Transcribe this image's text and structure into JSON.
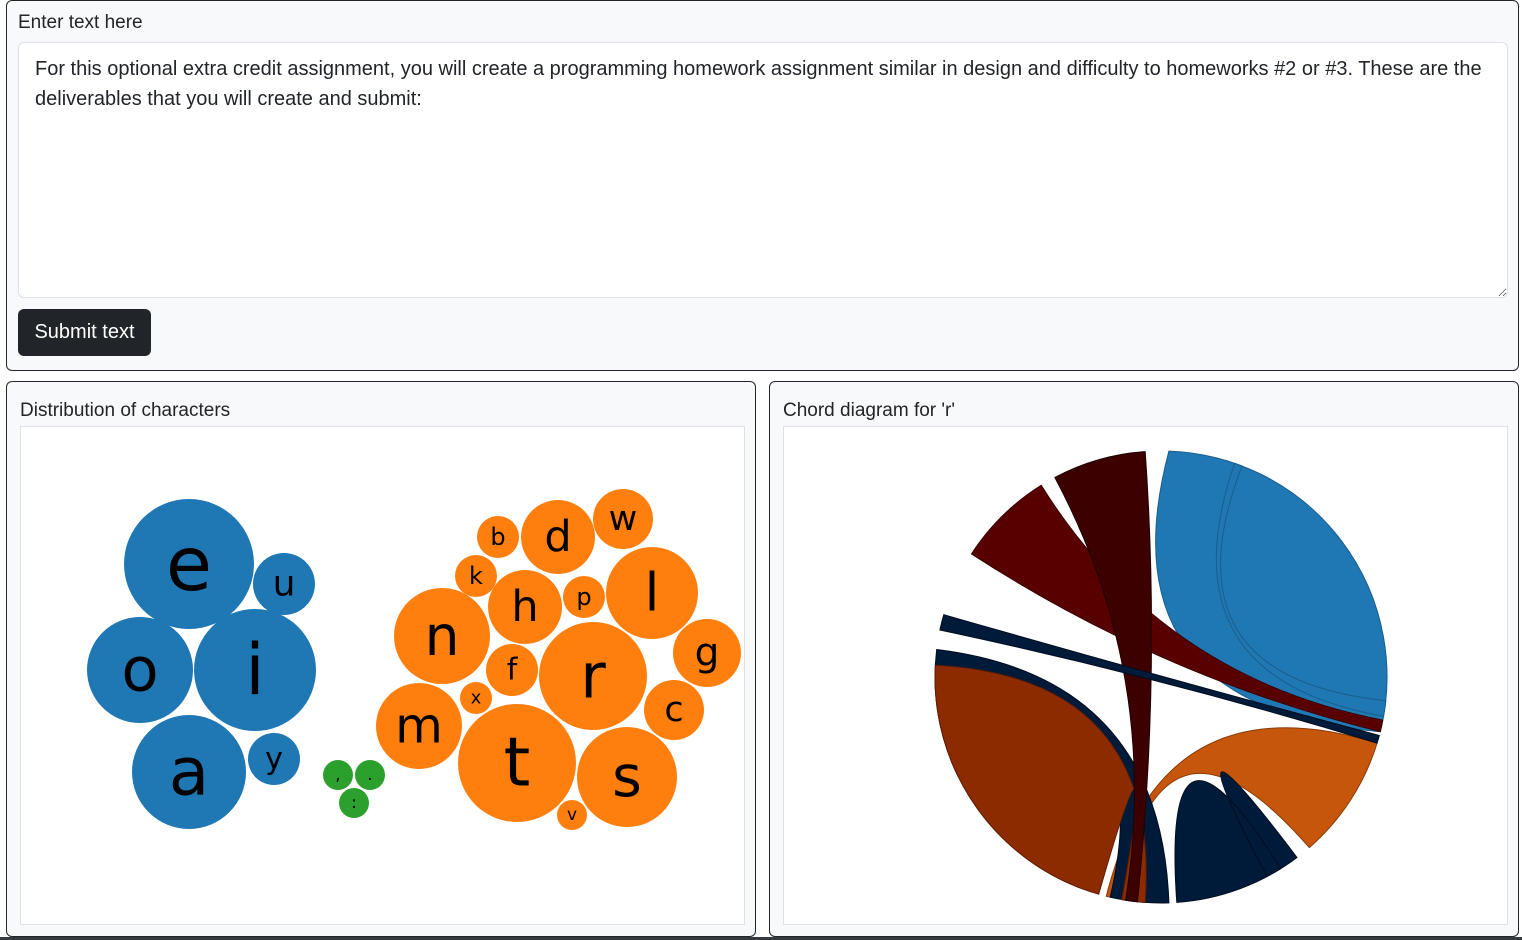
{
  "input_card": {
    "label": "Enter text here",
    "text_value": "For this optional extra credit assignment, you will create a programming homework assignment similar in design and difficulty to homeworks #2 or #3. These are the deliverables that you will create and submit:",
    "submit_label": "Submit text"
  },
  "distribution": {
    "title": "Distribution of characters",
    "colors": {
      "vowels": "#1f77b4",
      "punctuation": "#2ca02c",
      "consonants": "#ff7f0e"
    }
  },
  "chord": {
    "title": "Chord diagram for 'r'",
    "colors": [
      "#1f77b4",
      "#c5560b",
      "#001a39",
      "#8c2a00",
      "#580000",
      "#3c0000"
    ]
  },
  "chart_data": [
    {
      "type": "bubble",
      "title": "Distribution of characters",
      "groups": [
        {
          "name": "vowels",
          "items": [
            {
              "char": "e",
              "count": 27
            },
            {
              "char": "i",
              "count": 24
            },
            {
              "char": "a",
              "count": 21
            },
            {
              "char": "o",
              "count": 18
            },
            {
              "char": "u",
              "count": 6
            },
            {
              "char": "y",
              "count": 4
            }
          ]
        },
        {
          "name": "punctuation",
          "items": [
            {
              "char": ",",
              "count": 1
            },
            {
              "char": ".",
              "count": 1
            },
            {
              "char": ":",
              "count": 1
            }
          ]
        },
        {
          "name": "consonants",
          "items": [
            {
              "char": "t",
              "count": 22
            },
            {
              "char": "r",
              "count": 19
            },
            {
              "char": "s",
              "count": 16
            },
            {
              "char": "n",
              "count": 15
            },
            {
              "char": "l",
              "count": 13
            },
            {
              "char": "m",
              "count": 12
            },
            {
              "char": "h",
              "count": 9
            },
            {
              "char": "d",
              "count": 8
            },
            {
              "char": "g",
              "count": 7
            },
            {
              "char": "c",
              "count": 6
            },
            {
              "char": "f",
              "count": 4
            },
            {
              "char": "w",
              "count": 5
            },
            {
              "char": "b",
              "count": 3
            },
            {
              "char": "k",
              "count": 3
            },
            {
              "char": "p",
              "count": 3
            },
            {
              "char": "x",
              "count": 2
            },
            {
              "char": "v",
              "count": 2
            }
          ]
        }
      ]
    },
    {
      "type": "chord",
      "title": "Chord diagram for 'r'",
      "arcs": [
        {
          "color": "#1f77b4"
        },
        {
          "color": "#c5560b"
        },
        {
          "color": "#001a39"
        },
        {
          "color": "#001a39"
        },
        {
          "color": "#8c2a00"
        },
        {
          "color": "#001a39"
        },
        {
          "color": "#580000"
        },
        {
          "color": "#3c0000"
        }
      ]
    }
  ]
}
